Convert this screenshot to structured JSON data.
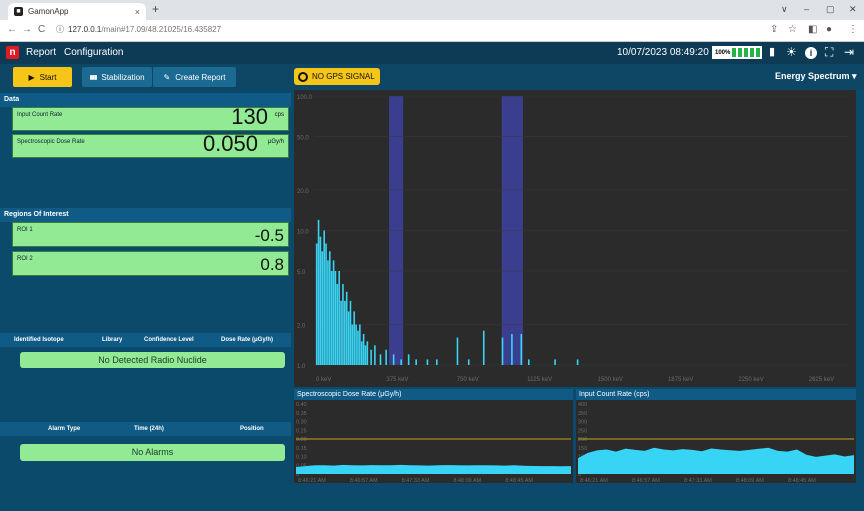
{
  "browser": {
    "tab_title": "GamonApp",
    "tab_close": "×",
    "new_tab": "+",
    "url_host": "127.0.0.1",
    "url_path": "/main#17.09/48.21025/16.435827",
    "back": "←",
    "forward": "→",
    "reload": "C",
    "info": "ⓘ",
    "minimize": "–",
    "maximize": "▢",
    "close": "✕",
    "collapse": "∨",
    "share": "⇪",
    "star": "☆",
    "panel": "◧",
    "profile": "●",
    "more": "⋮"
  },
  "app": {
    "logo": "n",
    "menu": [
      "Report",
      "Configuration"
    ],
    "datetime": "10/07/2023 08:49:20",
    "battery_pct": "100%",
    "battery_level": 1.0,
    "icons": {
      "phone": "▮",
      "sun": "☀",
      "info": "i",
      "fullscreen": "⛶",
      "logout": "⇥"
    }
  },
  "toolbar": {
    "start_icon": "▶",
    "start": "Start",
    "stab_icon": "▮▮▮",
    "stabilization": "Stabilization",
    "report_icon": "✎",
    "create_report": "Create Report",
    "gps": "NO GPS SIGNAL",
    "view_select": "Energy Spectrum ▾"
  },
  "data": {
    "header": "Data",
    "icr_label": "Input Count Rate",
    "icr_value": "130",
    "icr_unit": "cps",
    "dose_label": "Spectroscopic Dose Rate",
    "dose_value": "0.050",
    "dose_unit": "μGy/h"
  },
  "roi": {
    "header": "Regions Of Interest",
    "items": [
      {
        "label": "ROI 1",
        "value": "-0.5"
      },
      {
        "label": "ROI 2",
        "value": "0.8"
      }
    ]
  },
  "isotopes": {
    "columns": [
      "Identified Isotope",
      "Library",
      "Confidence Level",
      "Dose Rate (μGy/h)"
    ],
    "empty": "No Detected Radio Nuclide"
  },
  "alarms": {
    "columns": [
      "Alarm Type",
      "Time (24h)",
      "Position"
    ],
    "empty": "No Alarms"
  },
  "colors": {
    "accent": "#f5c518",
    "card": "#92ea94",
    "bars": "#38d4f5",
    "roi": "#3b3e8f",
    "threshold": "#c8a018"
  },
  "chart_data": [
    {
      "type": "bar",
      "title": "",
      "xlabel": "",
      "ylabel": "",
      "y_scale": "log",
      "yticks": [
        "100.0",
        "50.0",
        "20.0",
        "10.0",
        "5.0",
        "2.0",
        "1.0"
      ],
      "xticks": [
        "0 keV",
        "375 keV",
        "750 keV",
        "1125 keV",
        "1500 keV",
        "1875 keV",
        "2250 keV",
        "2625 keV"
      ],
      "roi_bands_keV": [
        [
          400,
          475
        ],
        [
          1000,
          1113
        ]
      ],
      "bars_keV": [
        10,
        20,
        30,
        40,
        50,
        60,
        70,
        80,
        90,
        100,
        110,
        120,
        130,
        140,
        150,
        160,
        170,
        180,
        190,
        200,
        210,
        220,
        230,
        240,
        250,
        260,
        270,
        280,
        300,
        320,
        350,
        380,
        420,
        460,
        500,
        540,
        600,
        650,
        700,
        760,
        820,
        870,
        900,
        930,
        1000,
        1050,
        1100,
        1140,
        1200,
        1280,
        1400,
        1520,
        1600,
        1750,
        2000
      ],
      "bars_counts": [
        8,
        12,
        9,
        7,
        10,
        8,
        6,
        7,
        5,
        6,
        5,
        4,
        5,
        3,
        4,
        3,
        3.5,
        2.5,
        3,
        2,
        2.5,
        2,
        1.8,
        2,
        1.5,
        1.7,
        1.4,
        1.5,
        1.3,
        1.4,
        1.2,
        1.3,
        1.2,
        1.1,
        1.2,
        1.1,
        1.1,
        1.1,
        1.0,
        1.6,
        1.1,
        1.0,
        1.8,
        1.0,
        1.6,
        1.7,
        1.7,
        1.1,
        1.0,
        1.1,
        1.1,
        1.0,
        1.0,
        1.0,
        1.0
      ]
    },
    {
      "type": "area",
      "title": "Spectroscopic Dose Rate (μGy/h)",
      "yticks": [
        "0.40",
        "0.35",
        "0.30",
        "0.25",
        "0.20",
        "0.15",
        "0.10",
        "0.05",
        "0"
      ],
      "ylim": [
        0,
        0.4
      ],
      "threshold": 0.2,
      "xticks": [
        "8:46:21 AM",
        "8:46:57 AM",
        "8:47:33 AM",
        "8:48:09 AM",
        "8:48:45 AM"
      ],
      "values": [
        0.04,
        0.045,
        0.05,
        0.05,
        0.048,
        0.052,
        0.05,
        0.049,
        0.051,
        0.05,
        0.05,
        0.052,
        0.05,
        0.049,
        0.048,
        0.05,
        0.051,
        0.05,
        0.049,
        0.05,
        0.05,
        0.049,
        0.048,
        0.05,
        0.047,
        0.046,
        0.045,
        0.045,
        0.044,
        0.045
      ]
    },
    {
      "type": "area",
      "title": "Input Count Rate (cps)",
      "yticks": [
        "400",
        "350",
        "300",
        "250",
        "200",
        "150",
        "100",
        "50",
        "0"
      ],
      "ylim": [
        0,
        400
      ],
      "threshold": 200,
      "xticks": [
        "8:46:21 AM",
        "8:46:57 AM",
        "8:47:33 AM",
        "8:48:09 AM",
        "8:48:45 AM"
      ],
      "values": [
        90,
        120,
        135,
        140,
        128,
        145,
        138,
        132,
        150,
        140,
        135,
        142,
        138,
        130,
        146,
        140,
        136,
        132,
        138,
        144,
        150,
        132,
        128,
        140,
        110,
        98,
        105,
        112,
        100,
        108
      ]
    }
  ]
}
